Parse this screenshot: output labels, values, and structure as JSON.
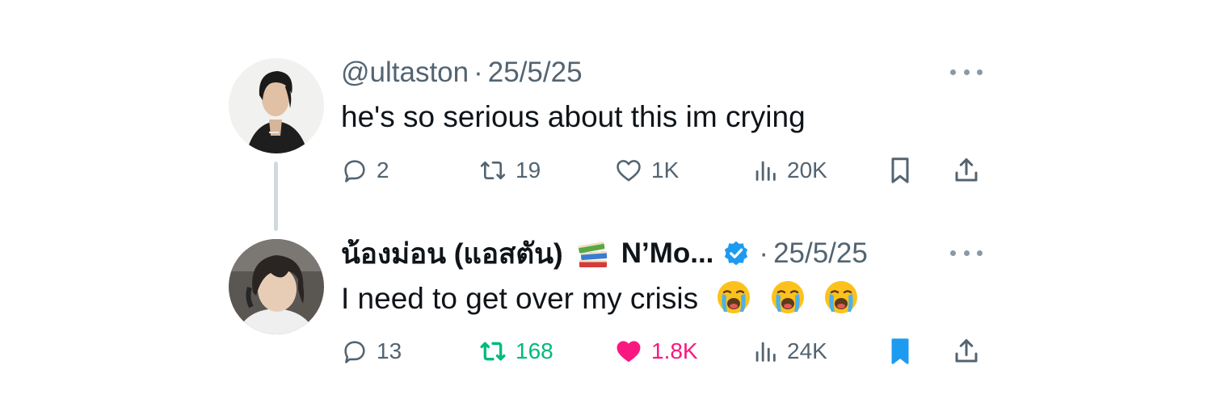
{
  "posts": [
    {
      "handle": "@ultaston",
      "separator": "·",
      "date": "25/5/25",
      "text": "he's so serious about this im crying",
      "stats": {
        "replies": "2",
        "reposts": "19",
        "likes": "1K",
        "views": "20K"
      },
      "reposted": false,
      "liked": false,
      "bookmarked": false
    },
    {
      "display_name": "น้องม่อน (แอสตัน)",
      "display_name_suffix": "N’Mo...",
      "name_emoji": "books-emoji",
      "verified": true,
      "separator": "·",
      "date": "25/5/25",
      "text": "I need to get over my crisis",
      "text_emojis": [
        "loudly-crying-face-emoji",
        "loudly-crying-face-emoji",
        "loudly-crying-face-emoji"
      ],
      "stats": {
        "replies": "13",
        "reposts": "168",
        "likes": "1.8K",
        "views": "24K"
      },
      "reposted": true,
      "liked": true,
      "bookmarked": true
    }
  ],
  "colors": {
    "text": "#0f1419",
    "muted": "#536471",
    "repost_active": "#00ba7c",
    "like_active": "#f91880",
    "bookmark_active": "#1d9bf0",
    "verified": "#1d9bf0",
    "thread_line": "#cfd9de"
  }
}
